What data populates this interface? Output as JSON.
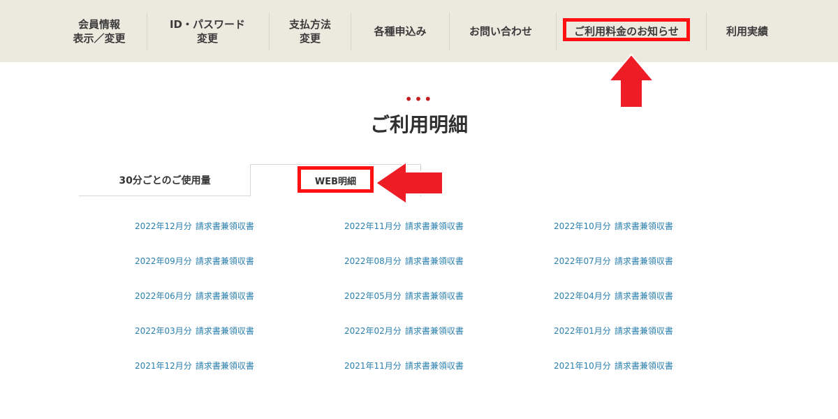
{
  "nav": {
    "items": [
      {
        "label": "会員情報\n表示／変更"
      },
      {
        "label": "ID・パスワード\n変更"
      },
      {
        "label": "支払方法\n変更"
      },
      {
        "label": "各種申込み"
      },
      {
        "label": "お問い合わせ"
      },
      {
        "label": "ご利用料金のお知らせ"
      },
      {
        "label": "利用実績"
      }
    ]
  },
  "main": {
    "dots": "•••",
    "title": "ご利用明細",
    "tabs": [
      {
        "label": "30分ごとのご使用量"
      },
      {
        "label": "WEB明細"
      }
    ],
    "statement_suffix": "請求書兼領収書",
    "statements": [
      [
        "2022年12月分",
        "2022年11月分",
        "2022年10月分"
      ],
      [
        "2022年09月分",
        "2022年08月分",
        "2022年07月分"
      ],
      [
        "2022年06月分",
        "2022年05月分",
        "2022年04月分"
      ],
      [
        "2022年03月分",
        "2022年02月分",
        "2022年01月分"
      ],
      [
        "2021年12月分",
        "2021年11月分",
        "2021年10月分"
      ]
    ]
  },
  "colors": {
    "nav_bg": "#ece9df",
    "link": "#2a7fae",
    "annotation_red": "#ff1111",
    "dots_red": "#c21e1e"
  }
}
